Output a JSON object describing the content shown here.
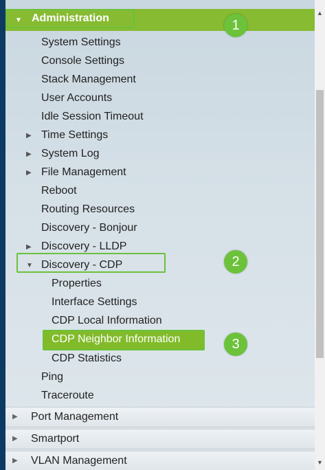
{
  "menu": {
    "header": "Administration",
    "items": [
      "System Settings",
      "Console Settings",
      "Stack Management",
      "User Accounts",
      "Idle Session Timeout",
      "Time Settings",
      "System Log",
      "File Management",
      "Reboot",
      "Routing Resources",
      "Discovery - Bonjour",
      "Discovery - LLDP",
      "Discovery - CDP"
    ],
    "cdp_items": [
      "Properties",
      "Interface Settings",
      "CDP Local Information",
      "CDP Neighbor Information",
      "CDP Statistics"
    ],
    "after": [
      "Ping",
      "Traceroute"
    ],
    "sections": [
      "Port Management",
      "Smartport",
      "VLAN Management"
    ]
  },
  "badges": [
    "1",
    "2",
    "3"
  ],
  "icons": {
    "expanded": "▼",
    "collapsed": "▶",
    "scroll_up": "▲",
    "scroll_down": "▼"
  },
  "colors": {
    "header_bg": "#86bb32",
    "highlight_outline": "#6bc13a",
    "badge_bg": "#6cc23a",
    "left_bar": "#0d3a63"
  }
}
